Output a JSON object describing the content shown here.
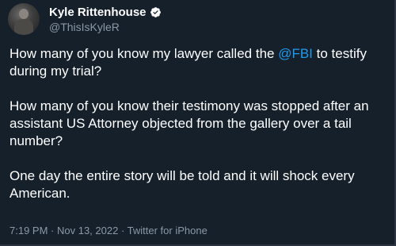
{
  "colors": {
    "background": "#15202b",
    "text": "#ffffff",
    "secondary_text": "#8b98a5",
    "accent": "#1d9bf0"
  },
  "user": {
    "display_name": "Kyle Rittenhouse",
    "handle": "@ThisIsKyleR",
    "verified_icon": "verified-badge-icon"
  },
  "tweet": {
    "p1_before": "How many of you know my lawyer called the ",
    "p1_mention": "@FBI",
    "p1_after": " to testify during my trial?",
    "p2": "How many of you know their testimony was stopped after an assistant US Attorney objected from the gallery over a tail number?",
    "p3": "One day the entire story will be told and it will shock every American."
  },
  "footer": {
    "time": "7:19 PM",
    "separator": " · ",
    "date": "Nov 13, 2022",
    "source": "Twitter for iPhone"
  }
}
